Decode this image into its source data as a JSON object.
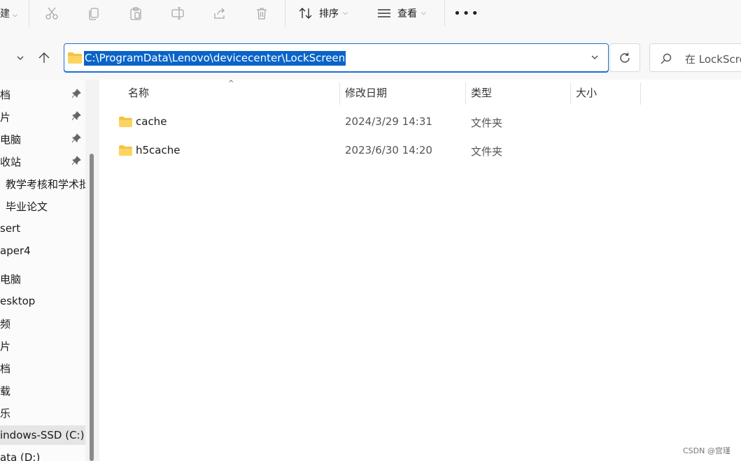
{
  "toolbar": {
    "new_label": "建",
    "sort_label": "排序",
    "view_label": "查看",
    "more_label": "•••",
    "icons": [
      "cut-icon",
      "copy-icon",
      "paste-icon",
      "rename-icon",
      "share-icon",
      "delete-icon",
      "sort-icon",
      "view-icon"
    ]
  },
  "address": {
    "path": "C:\\ProgramData\\Lenovo\\devicecenter\\LockScreen"
  },
  "search": {
    "placeholder": "在 LockScreen"
  },
  "sidebar": {
    "items": [
      {
        "label": "档",
        "pinned": true
      },
      {
        "label": "片",
        "pinned": true
      },
      {
        "label": "电脑",
        "pinned": true
      },
      {
        "label": "收站",
        "pinned": true
      },
      {
        "label": "教学考核和学术批",
        "pinned": false
      },
      {
        "label": "毕业论文",
        "pinned": false
      },
      {
        "label": "sert",
        "pinned": false
      },
      {
        "label": "aper4",
        "pinned": false
      },
      {
        "label": "电脑",
        "pinned": false
      },
      {
        "label": "esktop",
        "pinned": false
      },
      {
        "label": "频",
        "pinned": false
      },
      {
        "label": "片",
        "pinned": false
      },
      {
        "label": "档",
        "pinned": false
      },
      {
        "label": "载",
        "pinned": false
      },
      {
        "label": "乐",
        "pinned": false
      },
      {
        "label": "indows-SSD (C:)",
        "pinned": false,
        "selected": true
      },
      {
        "label": "ata (D:)",
        "pinned": false
      }
    ]
  },
  "columns": {
    "name": "名称",
    "date": "修改日期",
    "type": "类型",
    "size": "大小"
  },
  "files": [
    {
      "name": "cache",
      "date": "2024/3/29 14:31",
      "type": "文件夹"
    },
    {
      "name": "h5cache",
      "date": "2023/6/30 14:20",
      "type": "文件夹"
    }
  ],
  "watermark": "CSDN @宫瑾"
}
